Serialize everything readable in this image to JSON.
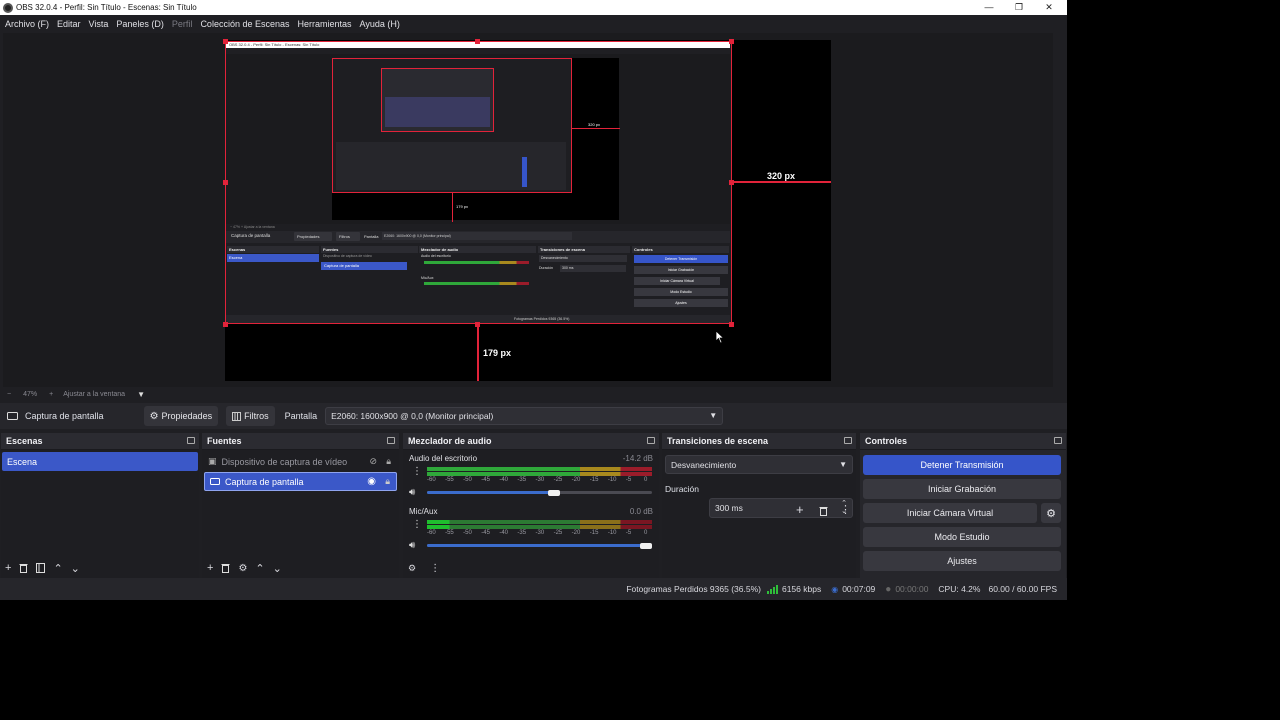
{
  "window": {
    "title": "OBS 32.0.4 - Perfil: Sin Título - Escenas: Sin Título",
    "controls": {
      "minimize": "—",
      "restore": "❐",
      "close": "✕"
    }
  },
  "menu": {
    "items": [
      "Archivo (F)",
      "Editar",
      "Vista",
      "Paneles (D)",
      "Perfil",
      "Colección de Escenas",
      "Herramientas",
      "Ayuda (H)"
    ]
  },
  "preview": {
    "measure_right": "320 px",
    "measure_bottom": "179 px",
    "nested_title": "OBS 32.0.4 - Perfil: Sin Título - Escenas: Sin Título",
    "nested_labels": {
      "source": "Captura de pantalla",
      "props": "Propiedades",
      "filters": "Filtros",
      "display": "Pantalla",
      "display_value": "E2060: 1600x900 @ 0,0 (Monitor principal)",
      "scenes": "Escenas",
      "scene": "Escena",
      "sources": "Fuentes",
      "src1": "Dispositivo de captura de vídeo",
      "src2": "Captura de pantalla",
      "mixer": "Mezclador de audio",
      "desktop": "Audio del escritorio",
      "mic": "Mic/Aux",
      "trans": "Transiciones de escena",
      "fade": "Desvanecimiento",
      "duration": "Duración",
      "duration_val": "300 ms",
      "controls": "Controles",
      "stop": "Detener Transmisión",
      "rec": "Iniciar Grabación",
      "vcam": "Iniciar Cámara Virtual",
      "studio": "Modo Estudio",
      "settings": "Ajustes",
      "status": "Fotogramas Perdidos 9365 (36.5%)"
    }
  },
  "zoom": {
    "minus": "−",
    "value": "47%",
    "plus": "+",
    "fit": "Ajustar a la ventana"
  },
  "context": {
    "source_name": "Captura de pantalla",
    "properties": "Propiedades",
    "filters": "Filtros",
    "display_label": "Pantalla",
    "display_value": "E2060: 1600x900 @ 0,0 (Monitor principal)"
  },
  "scenes": {
    "title": "Escenas",
    "items": [
      "Escena"
    ]
  },
  "sources": {
    "title": "Fuentes",
    "items": [
      "Dispositivo de captura de vídeo",
      "Captura de pantalla"
    ]
  },
  "mixer": {
    "title": "Mezclador de audio",
    "channels": [
      {
        "name": "Audio del escritorio",
        "db": "-14.2 dB",
        "volume": 0.59
      },
      {
        "name": "Mic/Aux",
        "db": "0.0 dB",
        "volume": 1.0
      }
    ],
    "ticks": [
      "-60",
      "-55",
      "-50",
      "-45",
      "-40",
      "-35",
      "-30",
      "-25",
      "-20",
      "-15",
      "-10",
      "-5",
      "0"
    ]
  },
  "transitions": {
    "title": "Transiciones de escena",
    "selected": "Desvanecimiento",
    "duration_label": "Duración",
    "duration_value": "300 ms"
  },
  "controls": {
    "title": "Controles",
    "stop_stream": "Detener Transmisión",
    "start_recording": "Iniciar Grabación",
    "start_vcam": "Iniciar Cámara Virtual",
    "studio_mode": "Modo Estudio",
    "settings": "Ajustes"
  },
  "status": {
    "dropped": "Fotogramas Perdidos 9365 (36.5%)",
    "bitrate": "6156 kbps",
    "stream_time": "00:07:09",
    "rec_time": "00:00:00",
    "cpu": "CPU: 4.2%",
    "fps": "60.00 / 60.00 FPS"
  },
  "colors": {
    "accent": "#3b58c8",
    "primary_button": "#3655c9",
    "selection_red": "#e2233a",
    "meter_green": "#2fa83a",
    "meter_yellow": "#a8891e",
    "meter_red": "#9b1c2a"
  }
}
